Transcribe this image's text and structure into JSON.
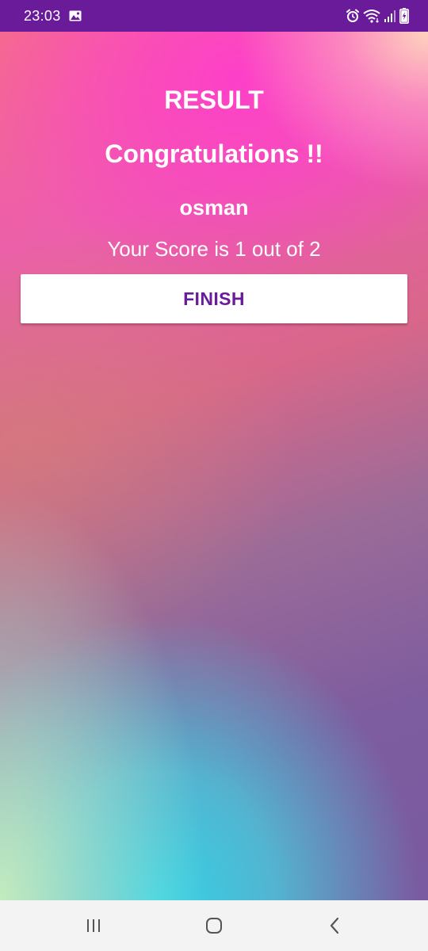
{
  "status_bar": {
    "time": "23:03",
    "icons": [
      "gallery-icon",
      "alarm-icon",
      "wifi-icon",
      "signal-icon",
      "battery-icon"
    ],
    "background": "#6a1b9a"
  },
  "result": {
    "title": "RESULT",
    "congrats": "Congratulations !!",
    "username": "osman",
    "score_text": "Your Score is 1 out of 2"
  },
  "finish_button": {
    "label": "FINISH",
    "text_color": "#6a1b9a"
  },
  "nav_bar": {
    "icons": [
      "recent-apps-icon",
      "home-icon",
      "back-icon"
    ]
  }
}
